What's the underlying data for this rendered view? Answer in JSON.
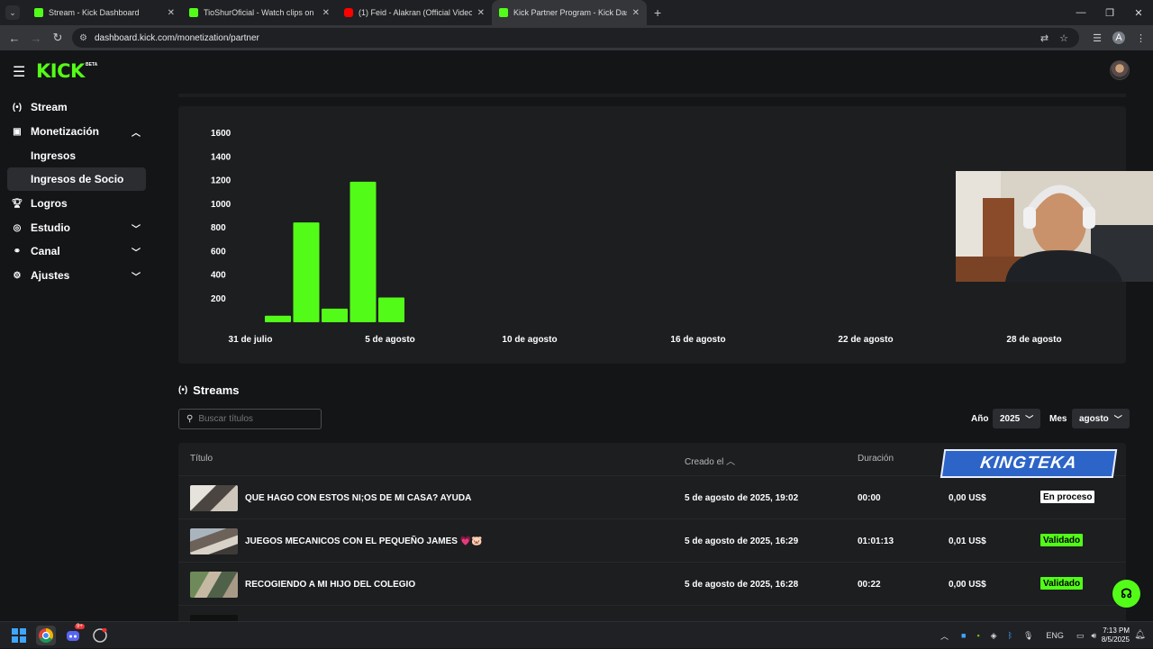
{
  "browser": {
    "tabs": [
      {
        "title": "Stream - Kick Dashboard",
        "favicon": "kick",
        "active": false
      },
      {
        "title": "TioShurOficial - Watch clips on",
        "favicon": "kick",
        "active": false
      },
      {
        "title": "(1) Feid - Alakran (Official Video",
        "favicon": "youtube",
        "active": false
      },
      {
        "title": "Kick Partner Program - Kick Dash",
        "favicon": "kick",
        "active": true
      }
    ],
    "url": "dashboard.kick.com/monetization/partner",
    "profile_initial": "A"
  },
  "header": {
    "logo": "KICK",
    "badge": "BETA"
  },
  "sidebar": {
    "items": [
      {
        "label": "Stream",
        "icon": "broadcast-icon"
      },
      {
        "label": "Monetización",
        "icon": "chart-icon",
        "expanded": true
      },
      {
        "label": "Ingresos",
        "sub": true
      },
      {
        "label": "Ingresos de Socio",
        "sub": true,
        "active": true
      },
      {
        "label": "Logros",
        "icon": "trophy-icon"
      },
      {
        "label": "Estudio",
        "icon": "studio-icon"
      },
      {
        "label": "Canal",
        "icon": "channel-icon"
      },
      {
        "label": "Ajustes",
        "icon": "gear-icon"
      }
    ]
  },
  "chart_data": {
    "type": "bar",
    "x_tick_labels": [
      "31 de julio",
      "5 de agosto",
      "10 de agosto",
      "16 de agosto",
      "22 de agosto",
      "28 de agosto"
    ],
    "y_ticks": [
      200,
      400,
      600,
      800,
      1000,
      1200,
      1400,
      1600
    ],
    "ylim": [
      0,
      1600
    ],
    "values": [
      55,
      845,
      115,
      1190,
      210
    ],
    "bar_color": "#53fc18",
    "grid": false,
    "title": "",
    "xlabel": "",
    "ylabel": ""
  },
  "streams": {
    "title": "Streams",
    "search_placeholder": "Buscar títulos",
    "year_label": "Año",
    "year_value": "2025",
    "month_label": "Mes",
    "month_value": "agosto",
    "columns": {
      "title": "Título",
      "created": "Creado el",
      "duration": "Duración"
    },
    "rows": [
      {
        "title": "QUE HAGO CON ESTOS NI;OS DE MI CASA? AYUDA",
        "created": "5 de agosto de 2025, 19:02",
        "duration": "00:00",
        "earnings": "0,00 US$",
        "status": "En proceso"
      },
      {
        "title": "JUEGOS MECANICOS CON EL PEQUEÑO JAMES 💗🐷",
        "created": "5 de agosto de 2025, 16:29",
        "duration": "01:01:13",
        "earnings": "0,01 US$",
        "status": "Validado"
      },
      {
        "title": "RECOGIENDO A MI HIJO DEL COLEGIO",
        "created": "5 de agosto de 2025, 16:28",
        "duration": "00:22",
        "earnings": "0,00 US$",
        "status": "Validado"
      }
    ]
  },
  "overlay": {
    "name": "KINGTEKA"
  },
  "taskbar": {
    "language": "ENG",
    "time": "7:13 PM",
    "date": "8/5/2025",
    "discord_badge": "9+"
  },
  "colors": {
    "accent": "#53fc18",
    "background": "#141517",
    "card": "#1c1e20"
  }
}
